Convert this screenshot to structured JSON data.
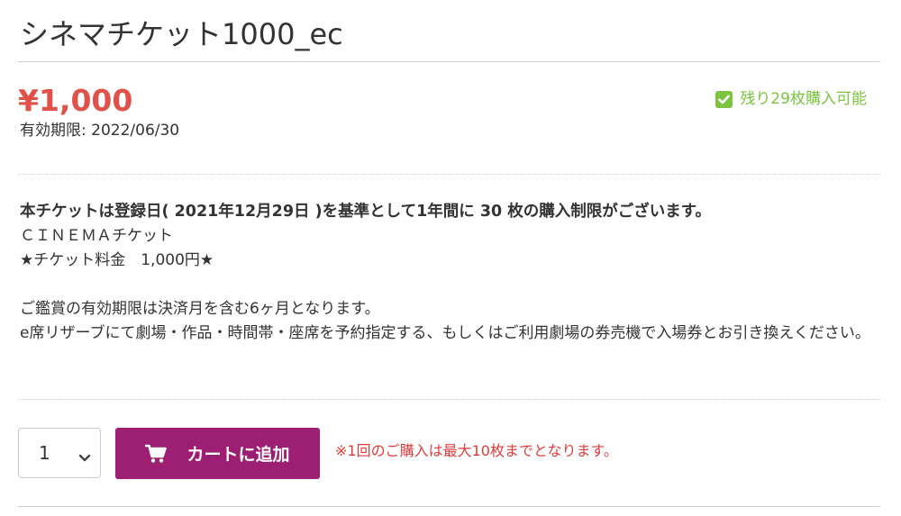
{
  "product": {
    "title": "シネマチケット1000_ec",
    "price": "¥1,000",
    "expiry": "有効期限: 2022/06/30",
    "stock_text": "残り29枚購入可能",
    "stock_icon": "checkbox-checked-icon"
  },
  "description": {
    "notice": "本チケットは登録日( 2021年12月29日 )を基準として1年間に 30 枚の購入制限がございます。",
    "lines": [
      "ＣＩＮＥＭＡチケット",
      "★チケット料金　1,000円★"
    ],
    "paragraph": [
      "ご鑑賞の有効期限は決済月を含む6ヶ月となります。",
      "e席リザーブにて劇場・作品・時間帯・座席を予約指定する、もしくはご利用劇場の券売機で入場券とお引き換えください。"
    ]
  },
  "purchase": {
    "quantity": "1",
    "quantity_icon": "chevron-down-icon",
    "add_to_cart_label": "カートに追加",
    "cart_icon": "cart-icon",
    "limit_note": "※1回のご購入は最大10枚までとなります。"
  },
  "colors": {
    "price": "#e0514a",
    "stock": "#7cc440",
    "cart_button": "#9c1f73",
    "limit_note": "#e03c3c"
  }
}
